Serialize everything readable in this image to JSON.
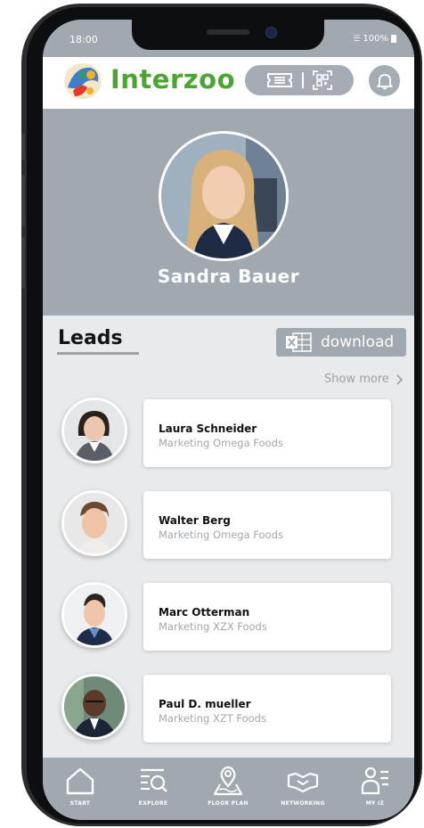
{
  "status_bar": {
    "time": "18:00",
    "battery": "100%"
  },
  "header": {
    "brand_name": "Interzoo",
    "brand_color": "#4aa532",
    "ticket_icon": "ticket-icon",
    "qr_icon": "qr-code-icon",
    "bell_icon": "bell-icon"
  },
  "profile": {
    "name": "Sandra Bauer"
  },
  "leads": {
    "title": "Leads",
    "download_label": "download",
    "show_more_label": "Show more",
    "items": [
      {
        "name": "Laura Schneider",
        "company": "Marketing Omega Foods"
      },
      {
        "name": "Walter Berg",
        "company": "Marketing Omega Foods"
      },
      {
        "name": "Marc Otterman",
        "company": "Marketing XZX Foods"
      },
      {
        "name": "Paul D. mueller",
        "company": "Marketing XZT Foods"
      }
    ]
  },
  "bottom_nav": {
    "items": [
      {
        "label": "START",
        "icon": "home-icon"
      },
      {
        "label": "EXPLORE",
        "icon": "explore-icon"
      },
      {
        "label": "FLOOR PLAN",
        "icon": "map-pin-icon"
      },
      {
        "label": "NETWORKING",
        "icon": "handshake-icon"
      },
      {
        "label": "MY IZ",
        "icon": "profile-list-icon"
      }
    ]
  },
  "colors": {
    "accent_gray": "#a0a8b0",
    "brand_green": "#4aa532",
    "background": "#e9eaec"
  }
}
